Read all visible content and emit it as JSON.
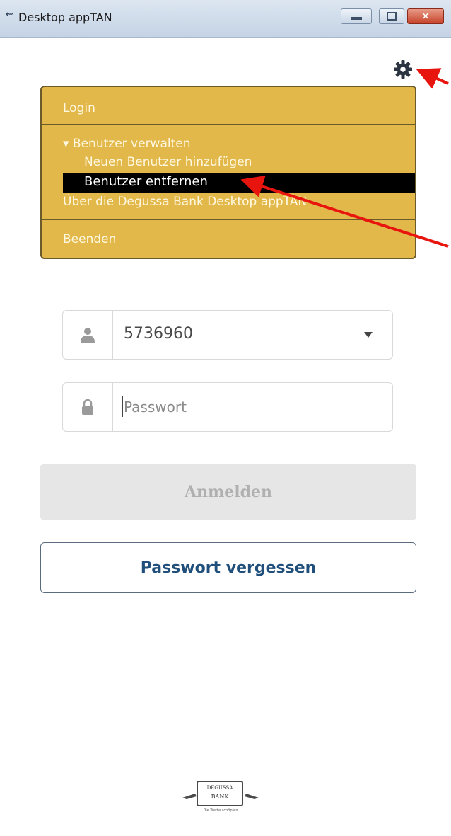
{
  "window": {
    "title": "Desktop appTAN",
    "close_glyph": "✕"
  },
  "menu": {
    "items": [
      {
        "label": "Login"
      },
      {
        "label": "▾ Benutzer verwalten"
      },
      {
        "label": "Neuen Benutzer hinzufügen"
      },
      {
        "label": "Benutzer entfernen",
        "selected": true
      },
      {
        "label": "Über die Degussa Bank Desktop appTAN"
      },
      {
        "label": "Beenden"
      }
    ]
  },
  "login": {
    "user_value": "5736960",
    "password_placeholder": "Passwort",
    "login_button": "Anmelden",
    "forgot_button": "Passwort vergessen"
  },
  "logo": {
    "line1": "DEGUSSA",
    "line2": "BANK",
    "tagline": "Die Werte schöpfen"
  },
  "colors": {
    "menu_bg": "#e2b84a",
    "highlight_bg": "#000000",
    "annotation_arrow": "#e8150f",
    "forgot_text": "#1f4f7a"
  },
  "icons": [
    "app-icon",
    "settings-gear-icon",
    "user-icon",
    "lock-icon",
    "chevron-down-icon"
  ]
}
